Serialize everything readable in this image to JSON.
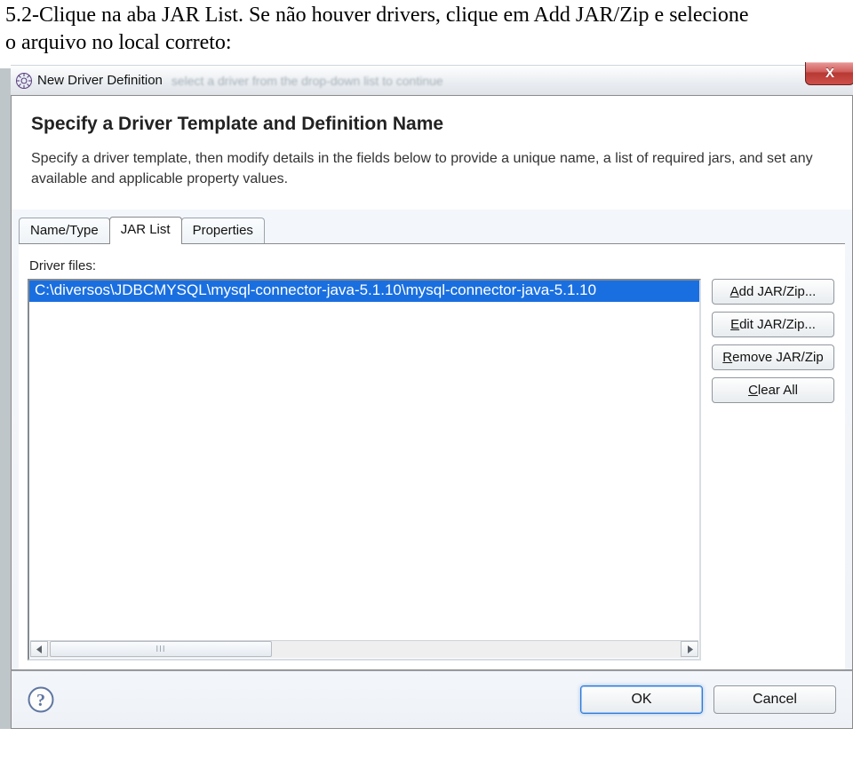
{
  "page_text": {
    "line1": "5.2-Clique na aba JAR List. Se não houver drivers, clique em Add JAR/Zip e selecione",
    "line2": "o arquivo no local correto:"
  },
  "titlebar": {
    "title": "New Driver Definition",
    "blur_hint": "select a driver from the drop-down list to continue",
    "close_glyph": "X"
  },
  "wizard": {
    "heading": "Specify a Driver Template and Definition Name",
    "description": "Specify a driver template, then modify details in the fields below to provide a unique name, a list of required jars, and set any available and applicable property values."
  },
  "tabs": {
    "name_type": "Name/Type",
    "jar_list": "JAR List",
    "properties": "Properties"
  },
  "jarlist": {
    "label": "Driver files:",
    "selected_path": "C:\\diversos\\JDBCMYSQL\\mysql-connector-java-5.1.10\\mysql-connector-java-5.1.10"
  },
  "buttons": {
    "add_pre": "",
    "add_u": "A",
    "add_post": "dd JAR/Zip...",
    "edit_pre": "",
    "edit_u": "E",
    "edit_post": "dit JAR/Zip...",
    "remove_pre": "",
    "remove_u": "R",
    "remove_post": "emove JAR/Zip",
    "clear_pre": "",
    "clear_u": "C",
    "clear_post": "lear All"
  },
  "footer": {
    "ok": "OK",
    "cancel": "Cancel"
  }
}
